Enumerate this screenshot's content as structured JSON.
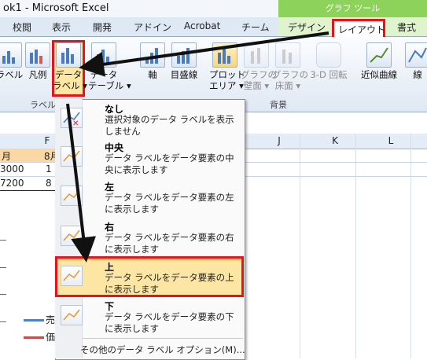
{
  "window": {
    "title": "ok1 - Microsoft Excel"
  },
  "context_tab_header": "グラフ ツール",
  "tabs": [
    "校閲",
    "表示",
    "開発",
    "アドイン",
    "Acrobat",
    "チーム",
    "デザイン",
    "レイアウト",
    "書式"
  ],
  "selected_tab": "レイアウト",
  "ribbon": {
    "buttons": [
      {
        "label": "ラベル",
        "label2": ""
      },
      {
        "label": "凡例",
        "label2": ""
      },
      {
        "label": "データ",
        "label2": "ラベル ▾"
      },
      {
        "label": "データ",
        "label2": "テーブル ▾"
      },
      {
        "label": "軸",
        "label2": ""
      },
      {
        "label": "目盛線",
        "label2": ""
      },
      {
        "label": "プロット",
        "label2": "エリア ▾"
      },
      {
        "label": "グラフの",
        "label2": "壁面 ▾"
      },
      {
        "label": "グラフの",
        "label2": "床面 ▾"
      },
      {
        "label": "3-D 回転",
        "label2": ""
      },
      {
        "label": "近似曲線",
        "label2": ""
      },
      {
        "label": "線",
        "label2": ""
      }
    ],
    "groups": [
      "ラベル",
      "背景"
    ]
  },
  "sheet": {
    "columns": [
      "F",
      "J",
      "K",
      "L"
    ],
    "cells": [
      {
        "text": "月",
        "row": 1
      },
      {
        "text": "8月",
        "row": 1
      },
      {
        "text": "3000",
        "row": 2
      },
      {
        "text": "1",
        "row": 2
      },
      {
        "text": "7200",
        "row": 3
      },
      {
        "text": "8",
        "row": 3
      }
    ],
    "legend": [
      "売",
      "価"
    ]
  },
  "menu": {
    "items": [
      {
        "title": "なし",
        "desc": "選択対象のデータ ラベルを表示しません"
      },
      {
        "title": "中央",
        "desc": "データ ラベルをデータ要素の中央に表示します"
      },
      {
        "title": "左",
        "desc": "データ ラベルをデータ要素の左に表示します"
      },
      {
        "title": "右",
        "desc": "データ ラベルをデータ要素の右に表示します"
      },
      {
        "title": "上",
        "desc": "データ ラベルをデータ要素の上に表示します"
      },
      {
        "title": "下",
        "desc": "データ ラベルをデータ要素の下に表示します"
      }
    ],
    "more_options": "その他のデータ ラベル オプション(M)..."
  },
  "colors": {
    "highlight_red": "#e3141e",
    "context_green": "#8dd35b",
    "hover_orange": "#fde6a4"
  }
}
